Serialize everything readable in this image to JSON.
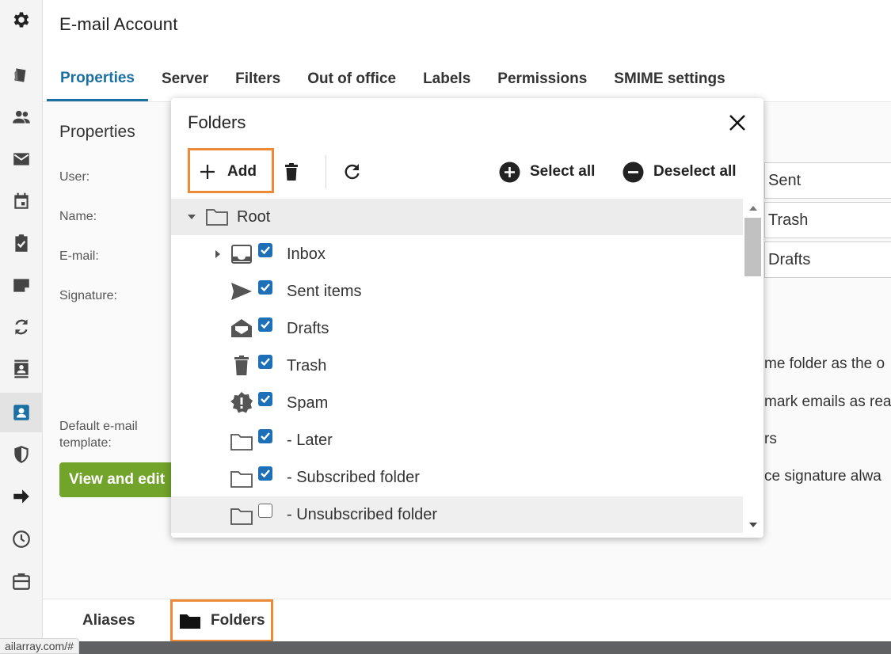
{
  "window": {
    "title": "E-mail Account"
  },
  "tabs": [
    "Properties",
    "Server",
    "Filters",
    "Out of office",
    "Labels",
    "Permissions",
    "SMIME settings"
  ],
  "properties": {
    "heading": "Properties",
    "labels": {
      "user": "User:",
      "name": "Name:",
      "email": "E-mail:",
      "signature": "Signature:",
      "template_line1": "Default e-mail",
      "template_line2": "template:"
    },
    "view_button": "View and edit",
    "folder_fields": [
      "Sent",
      "Trash",
      "Drafts"
    ],
    "truncated_options": [
      "me folder as the o",
      "mark emails as rea",
      "rs",
      "ce signature alwa"
    ]
  },
  "footer_tabs": {
    "aliases": "Aliases",
    "folders": "Folders"
  },
  "status_url": "ailarray.com/#",
  "dialog": {
    "title": "Folders",
    "toolbar": {
      "add": "Add",
      "select_all": "Select all",
      "deselect_all": "Deselect all"
    },
    "tree": [
      {
        "label": "Root",
        "icon": "folder-icon",
        "checked": null,
        "expander": "expanded"
      },
      {
        "label": "Inbox",
        "icon": "inbox-icon",
        "checked": true,
        "expander": "collapsed"
      },
      {
        "label": "Sent items",
        "icon": "send-icon",
        "checked": true,
        "expander": null
      },
      {
        "label": "Drafts",
        "icon": "drafts-icon",
        "checked": true,
        "expander": null
      },
      {
        "label": "Trash",
        "icon": "trash-icon",
        "checked": true,
        "expander": null
      },
      {
        "label": "Spam",
        "icon": "spam-icon",
        "checked": true,
        "expander": null
      },
      {
        "label": "- Later",
        "icon": "folder-icon",
        "checked": true,
        "expander": null
      },
      {
        "label": "- Subscribed folder",
        "icon": "folder-icon",
        "checked": true,
        "expander": null
      },
      {
        "label": "- Unsubscribed folder",
        "icon": "folder-icon",
        "checked": false,
        "expander": null
      }
    ]
  },
  "colors": {
    "accent": "#1a6fa3",
    "checkbox": "#1d6fb8",
    "highlight": "#ee8a35",
    "button_green": "#72a32b"
  }
}
